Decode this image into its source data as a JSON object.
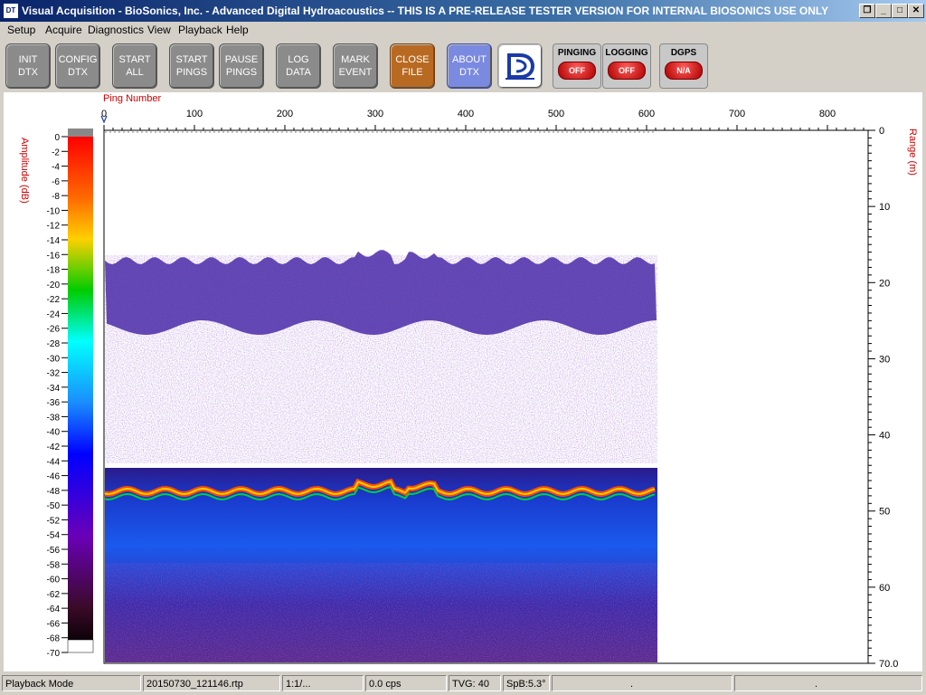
{
  "window": {
    "title": "Visual Acquisition  -  BioSonics, Inc.  -  Advanced Digital Hydroacoustics  -- THIS IS A PRE-RELEASE TESTER VERSION FOR INTERNAL BIOSONICS USE ONLY",
    "app_icon_text": "DT"
  },
  "menu": [
    "Setup",
    "Acquire",
    "Diagnostics",
    "View",
    "Playback",
    "Help"
  ],
  "toolbar": {
    "buttons": [
      {
        "label": "INIT\nDTX"
      },
      {
        "label": "CONFIG\nDTX"
      },
      {
        "label": "START\nALL"
      },
      {
        "label": "START\nPINGS"
      },
      {
        "label": "PAUSE\nPINGS"
      },
      {
        "label": "LOG\nDATA"
      },
      {
        "label": "MARK\nEVENT"
      },
      {
        "label": "CLOSE\nFILE"
      },
      {
        "label": "ABOUT\nDTX"
      }
    ],
    "status_buttons": [
      {
        "label": "PINGING",
        "state": "OFF"
      },
      {
        "label": "LOGGING",
        "state": "OFF"
      },
      {
        "label": "DGPS",
        "state": "N/A"
      }
    ]
  },
  "plot": {
    "x_axis_label": "Ping Number",
    "x_ticks": [
      "0",
      "100",
      "200",
      "300",
      "400",
      "500",
      "600",
      "700",
      "800"
    ],
    "y_right_label": "Range (m)",
    "y_right_ticks": [
      "0",
      "10",
      "20",
      "30",
      "40",
      "50",
      "60",
      "70.0"
    ],
    "colorbar_label": "Amplitude (dB)",
    "colorbar_ticks": [
      "0",
      "-2",
      "-4",
      "-6",
      "-8",
      "-10",
      "-12",
      "-14",
      "-16",
      "-18",
      "-20",
      "-22",
      "-24",
      "-26",
      "-28",
      "-30",
      "-32",
      "-34",
      "-36",
      "-38",
      "-40",
      "-42",
      "-44",
      "-46",
      "-48",
      "-50",
      "-52",
      "-54",
      "-56",
      "-58",
      "-60",
      "-62",
      "-64",
      "-66",
      "-68",
      "-70"
    ],
    "accent_color": "#cc0000"
  },
  "status": {
    "mode": "Playback Mode",
    "file": "20150730_121146.rtp",
    "ratio": "1:1/...",
    "rate": "0.0 cps",
    "tvg": "TVG: 40",
    "spb": "SpB:5.3°",
    "extra1": ".",
    "extra2": "."
  }
}
